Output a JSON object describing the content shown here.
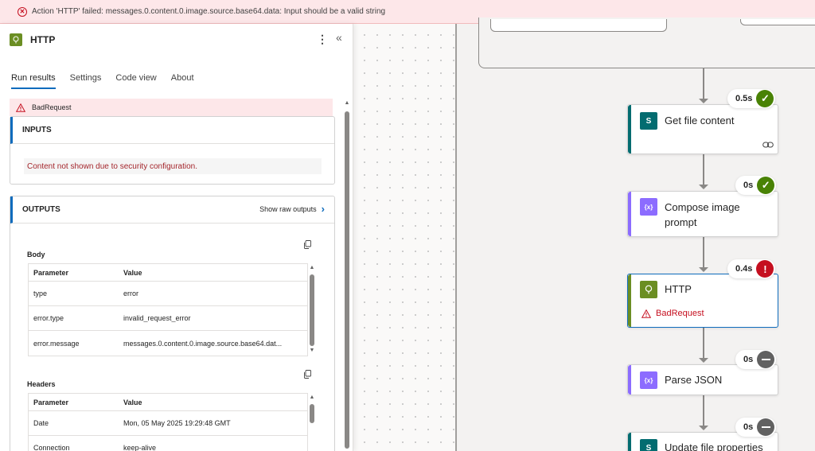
{
  "banner": {
    "message": "Action 'HTTP' failed: messages.0.content.0.image.source.base64.data: Input should be a valid string",
    "icon": "error-circle-icon",
    "color": "#c50f1f"
  },
  "panel": {
    "title": "HTTP",
    "icon": "http-icon",
    "more_icon": "more-vertical-icon",
    "more_glyph": "⋮",
    "collapse_icon": "double-chevron-left-icon",
    "collapse_glyph": "«",
    "tabs": [
      {
        "label": "Run results",
        "active": true
      },
      {
        "label": "Settings",
        "active": false
      },
      {
        "label": "Code view",
        "active": false
      },
      {
        "label": "About",
        "active": false
      }
    ],
    "status": "BadRequest",
    "inputs": {
      "title": "INPUTS",
      "message": "Content not shown due to security configuration."
    },
    "outputs": {
      "title": "OUTPUTS",
      "show_raw": "Show raw outputs",
      "body": {
        "label": "Body",
        "columns": [
          "Parameter",
          "Value"
        ],
        "rows": [
          {
            "param": "type",
            "value": "error"
          },
          {
            "param": "error.type",
            "value": "invalid_request_error"
          },
          {
            "param": "error.message",
            "value": "messages.0.content.0.image.source.base64.dat..."
          }
        ]
      },
      "headers": {
        "label": "Headers",
        "columns": [
          "Parameter",
          "Value"
        ],
        "rows": [
          {
            "param": "Date",
            "value": "Mon, 05 May 2025 19:29:48 GMT"
          },
          {
            "param": "Connection",
            "value": "keep-alive"
          }
        ]
      }
    }
  },
  "flow": {
    "nodes": [
      {
        "title": "Get file content",
        "duration": "0.5s",
        "status": "succeeded",
        "icon": "sharepoint-icon",
        "icon_glyph": "S",
        "accent": "#036c70"
      },
      {
        "title_line1": "Compose image",
        "title_line2": "prompt",
        "duration": "0s",
        "status": "succeeded",
        "icon": "compose-icon",
        "icon_glyph": "{x}",
        "accent": "#8c6cff"
      },
      {
        "title": "HTTP",
        "duration": "0.4s",
        "status": "failed",
        "error": "BadRequest",
        "icon": "http-icon",
        "accent": "#6b8e23"
      },
      {
        "title": "Parse JSON",
        "duration": "0s",
        "status": "skipped",
        "icon": "parse-json-icon",
        "icon_glyph": "{x}",
        "accent": "#8c6cff"
      },
      {
        "title": "Update file properties",
        "duration": "0s",
        "status": "skipped",
        "icon": "sharepoint-icon",
        "icon_glyph": "S",
        "accent": "#036c70"
      }
    ]
  },
  "glyphs": {
    "check": "✓",
    "exclaim": "!",
    "up": "▲",
    "down": "▼",
    "chevron_right": "›",
    "x": "✕"
  }
}
